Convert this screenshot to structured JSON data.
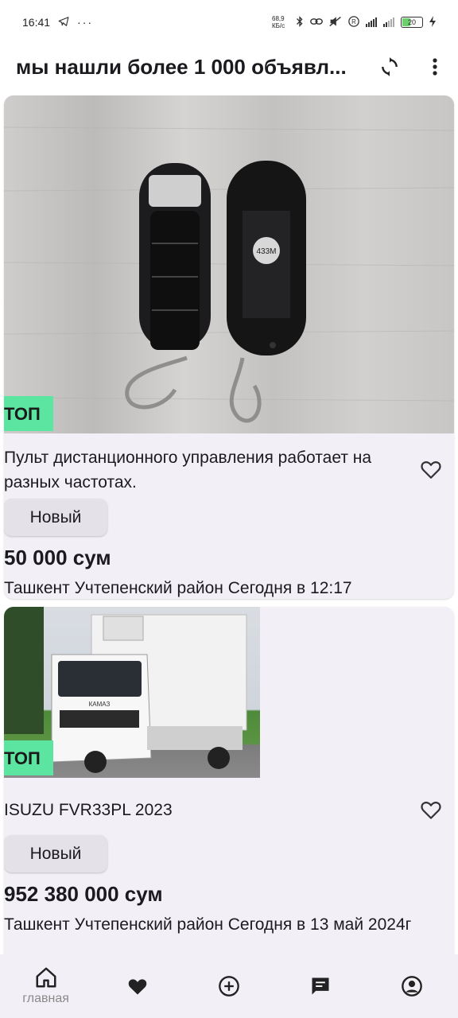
{
  "status_bar": {
    "time": "16:41",
    "net_speed": "68,9 КБ/с",
    "battery": "20"
  },
  "header": {
    "title": "мы нашли более 1 000 объявл..."
  },
  "listings": [
    {
      "badge": "ТОП",
      "description": "Пульт дистанционного управления работает на разных частотах.",
      "condition": "Новый",
      "price": "50 000 сум",
      "location": "Ташкент Учтепенский район Сегодня в  12:17",
      "image_label": "433M"
    },
    {
      "badge": "ТОП",
      "description": "ISUZU FVR33PL 2023",
      "condition": "Новый",
      "price": "952 380 000 сум",
      "location": "Ташкент Учтепенский район Сегодня в 13 май 2024г",
      "image_label": "КАМАЗ"
    }
  ],
  "bottom_nav": {
    "home_label": "главная"
  },
  "colors": {
    "badge": "#5be5a0",
    "card_bg": "#f3eff6",
    "chip_bg": "#e5e1e8"
  }
}
